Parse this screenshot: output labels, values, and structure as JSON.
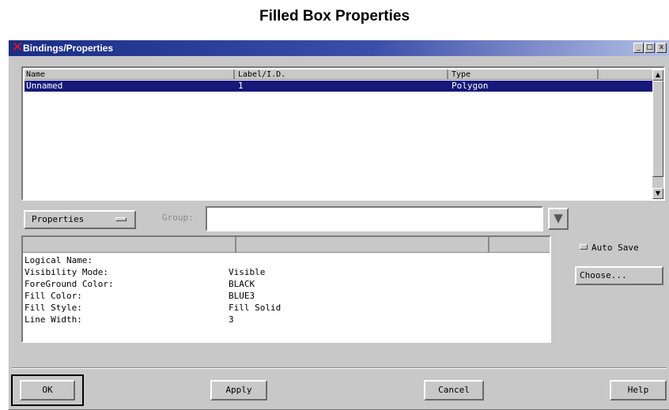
{
  "caption": "Filled Box Properties",
  "window": {
    "title": "Bindings/Properties",
    "controls": {
      "minimize": "_",
      "maximize": "□",
      "close": "x"
    }
  },
  "bindings_list": {
    "columns": [
      "Name",
      "Label/I.D.",
      "Type"
    ],
    "rows": [
      {
        "name": "Unnamed",
        "label": "1",
        "type": "Polygon",
        "selected": true
      }
    ]
  },
  "properties_dropdown": {
    "label": "Properties"
  },
  "group": {
    "label": "Group:",
    "value": ""
  },
  "properties": [
    {
      "name": "Logical Name:",
      "value": ""
    },
    {
      "name": "Visibility Mode:",
      "value": "Visible"
    },
    {
      "name": "ForeGround Color:",
      "value": "BLACK"
    },
    {
      "name": "Fill Color:",
      "value": "BLUE3"
    },
    {
      "name": "Fill Style:",
      "value": "Fill Solid"
    },
    {
      "name": "Line Width:",
      "value": "3"
    }
  ],
  "auto_save": {
    "label": "Auto Save",
    "checked": false
  },
  "choose_button": "Choose...",
  "buttons": {
    "ok": "OK",
    "apply": "Apply",
    "cancel": "Cancel",
    "help": "Help"
  },
  "colors": {
    "selection": "#16187a",
    "titlebar_start": "#1a2e86",
    "titlebar_end": "#b4bfe6",
    "face": "#c8c8c8"
  },
  "icons": {
    "app": "x-logo-icon",
    "scroll_up": "arrow-up-icon",
    "scroll_down": "arrow-down-icon",
    "group_dropdown": "triangle-down-icon"
  }
}
